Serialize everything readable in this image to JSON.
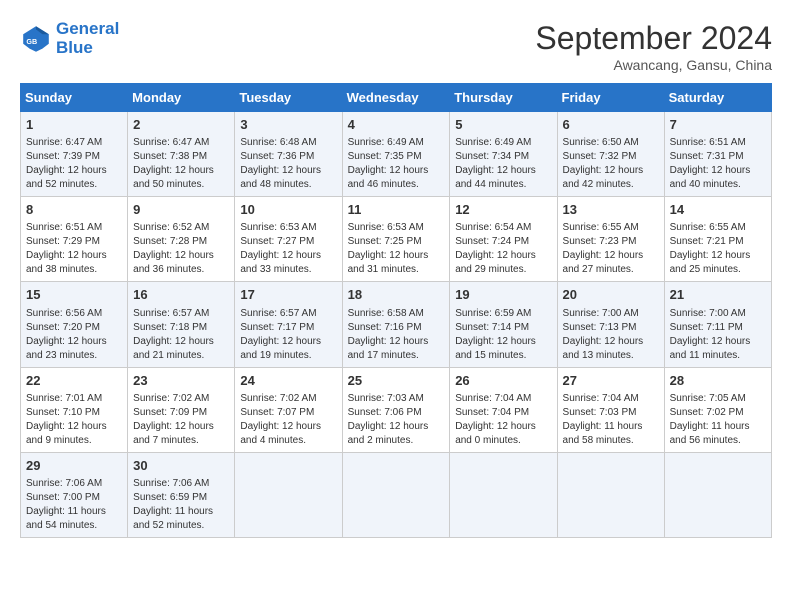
{
  "header": {
    "logo_line1": "General",
    "logo_line2": "Blue",
    "month": "September 2024",
    "location": "Awancang, Gansu, China"
  },
  "weekdays": [
    "Sunday",
    "Monday",
    "Tuesday",
    "Wednesday",
    "Thursday",
    "Friday",
    "Saturday"
  ],
  "weeks": [
    [
      {
        "day": "1",
        "info": "Sunrise: 6:47 AM\nSunset: 7:39 PM\nDaylight: 12 hours\nand 52 minutes."
      },
      {
        "day": "2",
        "info": "Sunrise: 6:47 AM\nSunset: 7:38 PM\nDaylight: 12 hours\nand 50 minutes."
      },
      {
        "day": "3",
        "info": "Sunrise: 6:48 AM\nSunset: 7:36 PM\nDaylight: 12 hours\nand 48 minutes."
      },
      {
        "day": "4",
        "info": "Sunrise: 6:49 AM\nSunset: 7:35 PM\nDaylight: 12 hours\nand 46 minutes."
      },
      {
        "day": "5",
        "info": "Sunrise: 6:49 AM\nSunset: 7:34 PM\nDaylight: 12 hours\nand 44 minutes."
      },
      {
        "day": "6",
        "info": "Sunrise: 6:50 AM\nSunset: 7:32 PM\nDaylight: 12 hours\nand 42 minutes."
      },
      {
        "day": "7",
        "info": "Sunrise: 6:51 AM\nSunset: 7:31 PM\nDaylight: 12 hours\nand 40 minutes."
      }
    ],
    [
      {
        "day": "8",
        "info": "Sunrise: 6:51 AM\nSunset: 7:29 PM\nDaylight: 12 hours\nand 38 minutes."
      },
      {
        "day": "9",
        "info": "Sunrise: 6:52 AM\nSunset: 7:28 PM\nDaylight: 12 hours\nand 36 minutes."
      },
      {
        "day": "10",
        "info": "Sunrise: 6:53 AM\nSunset: 7:27 PM\nDaylight: 12 hours\nand 33 minutes."
      },
      {
        "day": "11",
        "info": "Sunrise: 6:53 AM\nSunset: 7:25 PM\nDaylight: 12 hours\nand 31 minutes."
      },
      {
        "day": "12",
        "info": "Sunrise: 6:54 AM\nSunset: 7:24 PM\nDaylight: 12 hours\nand 29 minutes."
      },
      {
        "day": "13",
        "info": "Sunrise: 6:55 AM\nSunset: 7:23 PM\nDaylight: 12 hours\nand 27 minutes."
      },
      {
        "day": "14",
        "info": "Sunrise: 6:55 AM\nSunset: 7:21 PM\nDaylight: 12 hours\nand 25 minutes."
      }
    ],
    [
      {
        "day": "15",
        "info": "Sunrise: 6:56 AM\nSunset: 7:20 PM\nDaylight: 12 hours\nand 23 minutes."
      },
      {
        "day": "16",
        "info": "Sunrise: 6:57 AM\nSunset: 7:18 PM\nDaylight: 12 hours\nand 21 minutes."
      },
      {
        "day": "17",
        "info": "Sunrise: 6:57 AM\nSunset: 7:17 PM\nDaylight: 12 hours\nand 19 minutes."
      },
      {
        "day": "18",
        "info": "Sunrise: 6:58 AM\nSunset: 7:16 PM\nDaylight: 12 hours\nand 17 minutes."
      },
      {
        "day": "19",
        "info": "Sunrise: 6:59 AM\nSunset: 7:14 PM\nDaylight: 12 hours\nand 15 minutes."
      },
      {
        "day": "20",
        "info": "Sunrise: 7:00 AM\nSunset: 7:13 PM\nDaylight: 12 hours\nand 13 minutes."
      },
      {
        "day": "21",
        "info": "Sunrise: 7:00 AM\nSunset: 7:11 PM\nDaylight: 12 hours\nand 11 minutes."
      }
    ],
    [
      {
        "day": "22",
        "info": "Sunrise: 7:01 AM\nSunset: 7:10 PM\nDaylight: 12 hours\nand 9 minutes."
      },
      {
        "day": "23",
        "info": "Sunrise: 7:02 AM\nSunset: 7:09 PM\nDaylight: 12 hours\nand 7 minutes."
      },
      {
        "day": "24",
        "info": "Sunrise: 7:02 AM\nSunset: 7:07 PM\nDaylight: 12 hours\nand 4 minutes."
      },
      {
        "day": "25",
        "info": "Sunrise: 7:03 AM\nSunset: 7:06 PM\nDaylight: 12 hours\nand 2 minutes."
      },
      {
        "day": "26",
        "info": "Sunrise: 7:04 AM\nSunset: 7:04 PM\nDaylight: 12 hours\nand 0 minutes."
      },
      {
        "day": "27",
        "info": "Sunrise: 7:04 AM\nSunset: 7:03 PM\nDaylight: 11 hours\nand 58 minutes."
      },
      {
        "day": "28",
        "info": "Sunrise: 7:05 AM\nSunset: 7:02 PM\nDaylight: 11 hours\nand 56 minutes."
      }
    ],
    [
      {
        "day": "29",
        "info": "Sunrise: 7:06 AM\nSunset: 7:00 PM\nDaylight: 11 hours\nand 54 minutes."
      },
      {
        "day": "30",
        "info": "Sunrise: 7:06 AM\nSunset: 6:59 PM\nDaylight: 11 hours\nand 52 minutes."
      },
      {
        "day": "",
        "info": ""
      },
      {
        "day": "",
        "info": ""
      },
      {
        "day": "",
        "info": ""
      },
      {
        "day": "",
        "info": ""
      },
      {
        "day": "",
        "info": ""
      }
    ]
  ]
}
